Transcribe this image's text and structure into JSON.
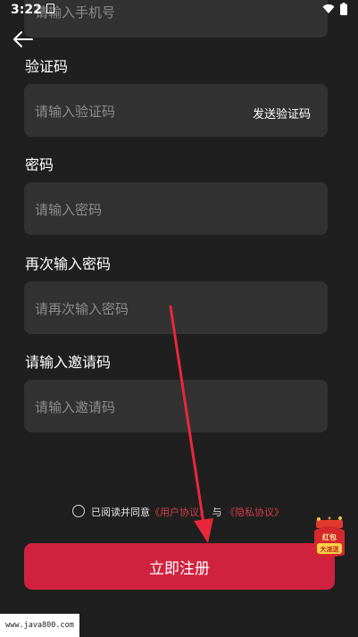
{
  "status_bar": {
    "time": "3:22"
  },
  "form": {
    "phone": {
      "placeholder": "请输入手机号"
    },
    "code": {
      "label": "验证码",
      "placeholder": "请输入验证码",
      "send_label": "发送验证码"
    },
    "password": {
      "label": "密码",
      "placeholder": "请输入密码"
    },
    "password_confirm": {
      "label": "再次输入密码",
      "placeholder": "请再次输入密码"
    },
    "invite": {
      "label": "请输入邀请码",
      "placeholder": "请输入邀请码"
    }
  },
  "agreement": {
    "prefix": "已阅读并同意",
    "user_agreement": "《用户协议》",
    "conjunction": "与",
    "privacy_agreement": "《隐私协议》"
  },
  "register_label": "立即注册",
  "promo_badge": {
    "line1": "红包",
    "line2": "大派送"
  },
  "watermark": "www.java800.com",
  "colors": {
    "background": "#1f1f1f",
    "input_background": "#323232",
    "accent": "#d0223e",
    "link": "#d23b4d",
    "annotation_arrow": "#e8283a"
  },
  "icons": {
    "back": "back-arrow-icon",
    "sim": "sim-card-icon",
    "wifi": "wifi-icon",
    "battery": "battery-icon",
    "radio": "radio-unchecked-icon"
  }
}
